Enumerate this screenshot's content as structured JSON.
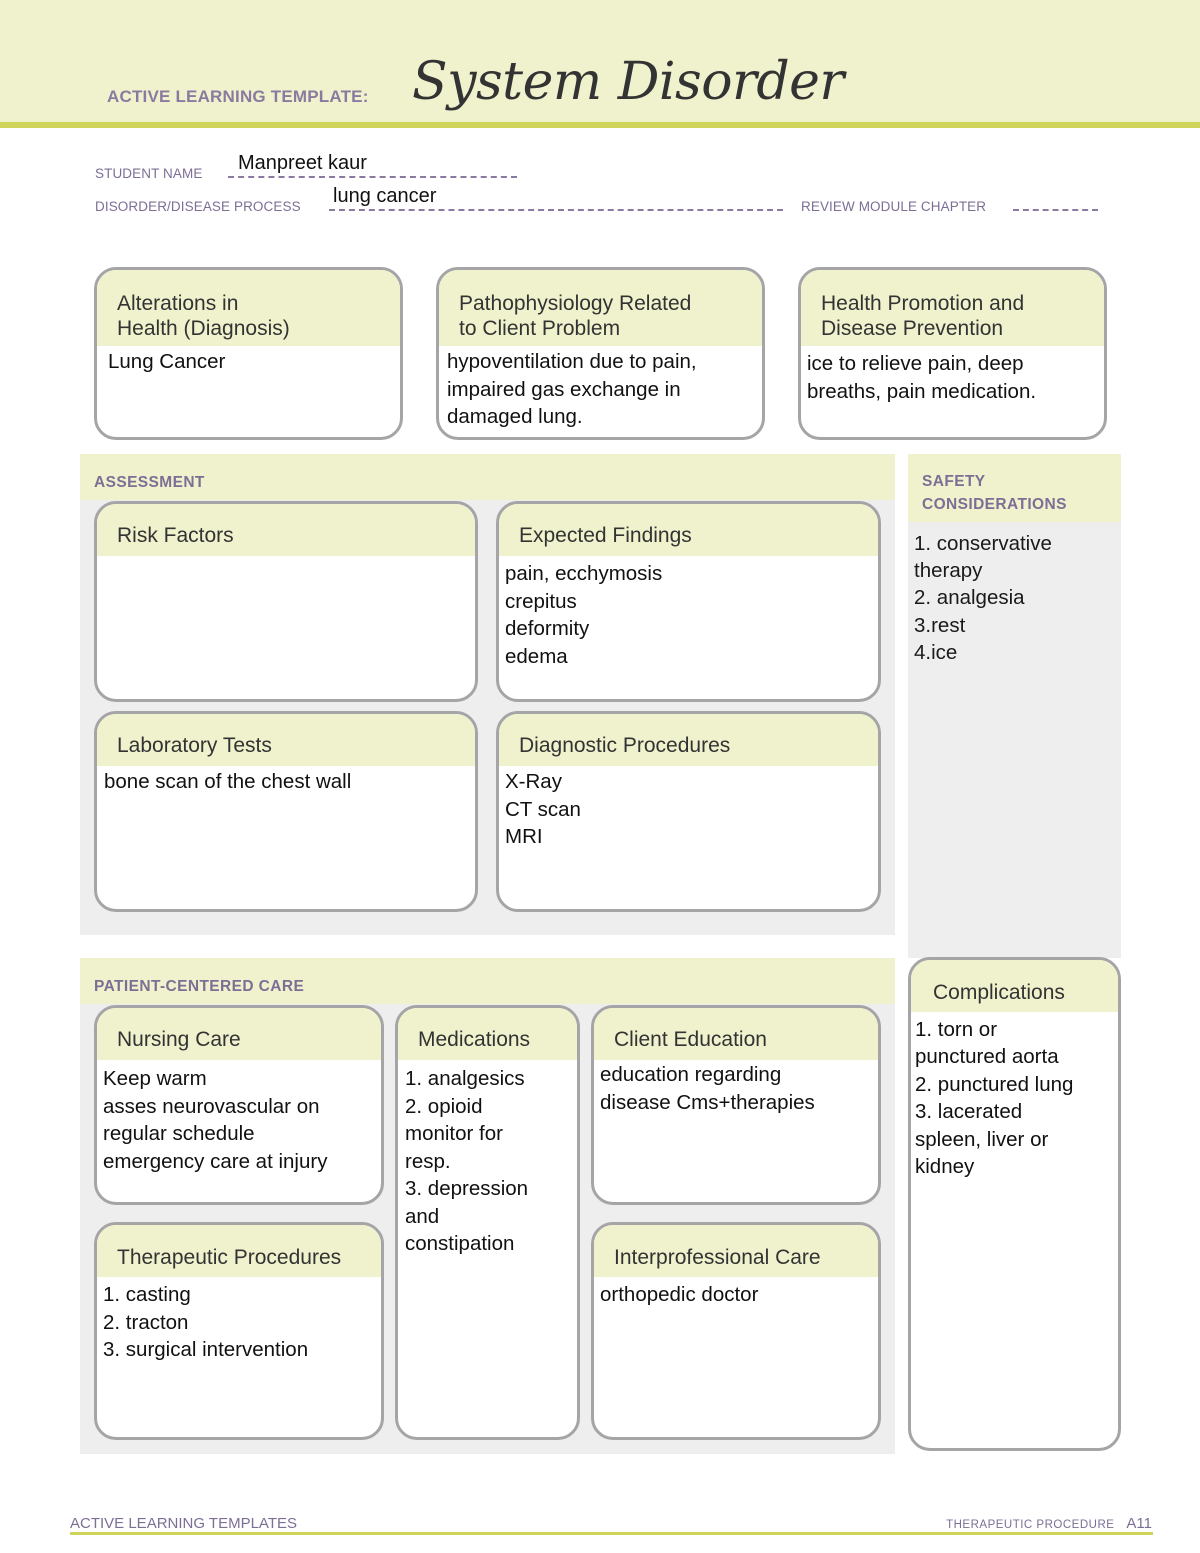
{
  "header": {
    "label": "ACTIVE LEARNING TEMPLATE:",
    "title": "System Disorder"
  },
  "fields": {
    "student_name_label": "STUDENT NAME",
    "student_name_value": "Manpreet kaur",
    "disorder_label": "DISORDER/DISEASE PROCESS",
    "disorder_value": "lung cancer",
    "review_chapter_label": "REVIEW MODULE CHAPTER",
    "review_chapter_value": ""
  },
  "top_boxes": {
    "alterations": {
      "title": "Alterations in\nHealth (Diagnosis)",
      "body": "Lung Cancer"
    },
    "pathophysiology": {
      "title": "Pathophysiology Related\nto Client Problem",
      "body": "hypoventilation due to pain,\nimpaired gas exchange in\ndamaged lung."
    },
    "health_promotion": {
      "title": "Health Promotion and\nDisease Prevention",
      "body": "ice to relieve pain, deep\nbreaths, pain medication."
    }
  },
  "assessment": {
    "title": "ASSESSMENT",
    "risk_factors": {
      "title": "Risk Factors",
      "body": ""
    },
    "expected_findings": {
      "title": "Expected Findings",
      "body": "pain, ecchymosis\ncrepitus\ndeformity\nedema"
    },
    "laboratory_tests": {
      "title": "Laboratory Tests",
      "body": "bone scan of the chest wall"
    },
    "diagnostic_procedures": {
      "title": "Diagnostic Procedures",
      "body": "X-Ray\nCT scan\nMRI"
    }
  },
  "safety": {
    "title": "SAFETY\nCONSIDERATIONS",
    "body": "1. conservative\ntherapy\n2. analgesia\n3.rest\n4.ice"
  },
  "patient_centered_care": {
    "title": "PATIENT-CENTERED CARE",
    "nursing_care": {
      "title": "Nursing Care",
      "body": "Keep warm\nasses neurovascular on\nregular schedule\nemergency care at injury"
    },
    "medications": {
      "title": "Medications",
      "body": "1. analgesics\n2. opioid\nmonitor for\nresp.\n3. depression\nand\nconstipation"
    },
    "client_education": {
      "title": "Client Education",
      "body": "education regarding\ndisease Cms+therapies"
    },
    "therapeutic_procedures": {
      "title": "Therapeutic Procedures",
      "body": "1. casting\n2. tracton\n3. surgical intervention"
    },
    "interprofessional_care": {
      "title": "Interprofessional Care",
      "body": "orthopedic doctor"
    }
  },
  "complications": {
    "title": "Complications",
    "body": "1. torn or\npunctured aorta\n2. punctured lung\n3. lacerated\nspleen, liver or\nkidney"
  },
  "footer": {
    "left": "ACTIVE LEARNING TEMPLATES",
    "right_label": "THERAPEUTIC PROCEDURE",
    "page": "A11"
  }
}
